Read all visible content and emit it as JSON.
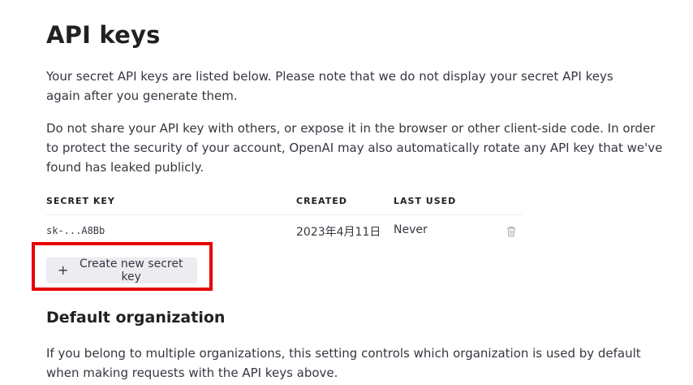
{
  "page": {
    "title": "API keys",
    "description_1": "Your secret API keys are listed below. Please note that we do not display your secret API keys again after you generate them.",
    "description_2": "Do not share your API key with others, or expose it in the browser or other client-side code. In order to protect the security of your account, OpenAI may also automatically rotate any API key that we've found has leaked publicly."
  },
  "keys_table": {
    "columns": {
      "secret_key": "SECRET KEY",
      "created": "CREATED",
      "last_used": "LAST USED"
    },
    "rows": [
      {
        "secret_key": "sk-...A8Bb",
        "created": "2023年4月11日",
        "last_used": "Never",
        "action_icon": "trash-icon"
      }
    ]
  },
  "actions": {
    "create_button_icon": "+",
    "create_button_label": "Create new secret key"
  },
  "default_org": {
    "title": "Default organization",
    "description": "If you belong to multiple organizations, this setting controls which organization is used by default when making requests with the API keys above."
  },
  "colors": {
    "highlight": "#e60000",
    "button_bg": "#ececf1",
    "text": "#353740",
    "heading": "#202123"
  }
}
